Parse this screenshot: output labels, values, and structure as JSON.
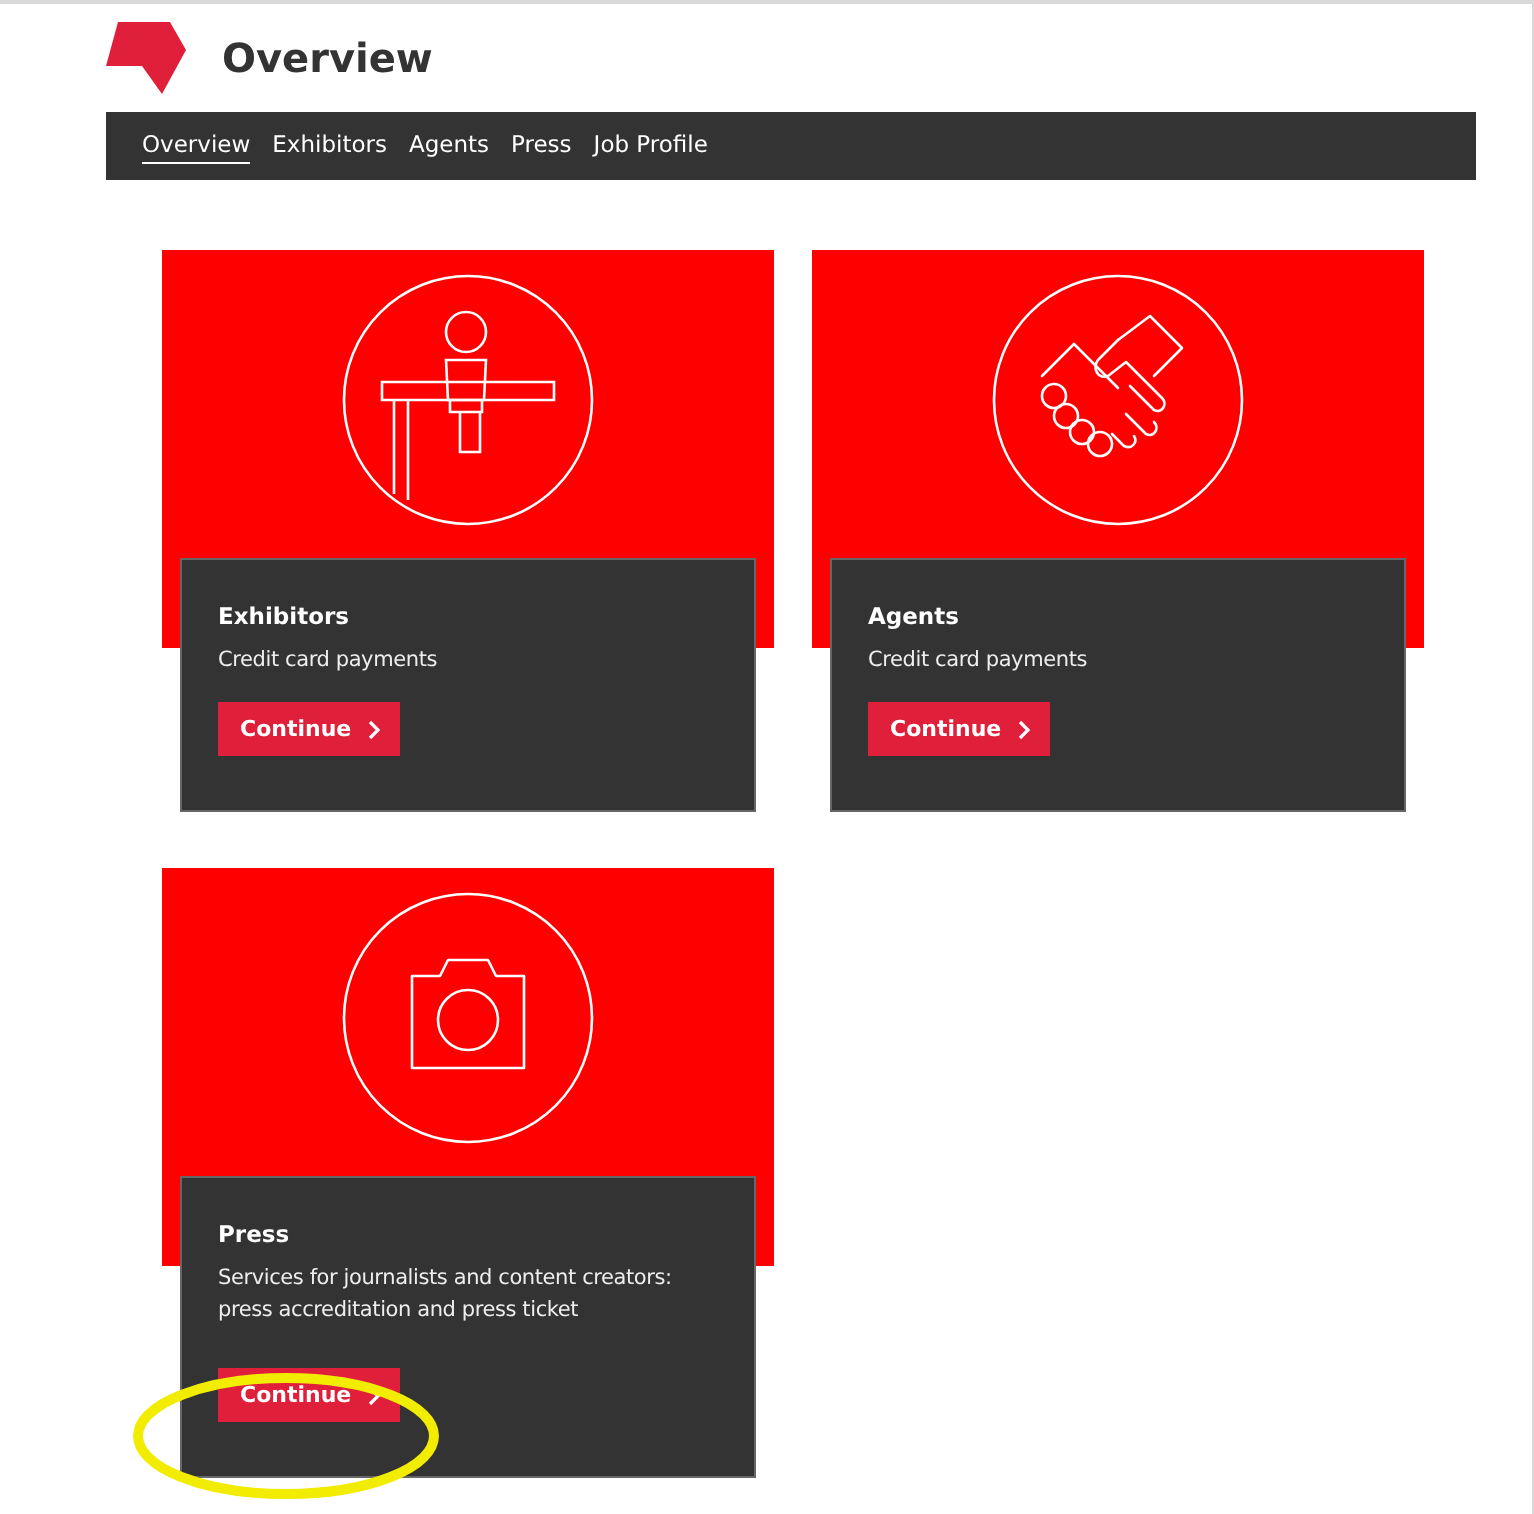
{
  "header": {
    "title": "Overview"
  },
  "nav": [
    {
      "label": "Overview",
      "selected": true
    },
    {
      "label": "Exhibitors",
      "selected": false
    },
    {
      "label": "Agents",
      "selected": false
    },
    {
      "label": "Press",
      "selected": false
    },
    {
      "label": "Job Profile",
      "selected": false
    }
  ],
  "cards": [
    {
      "kind": "exhibitor",
      "title": "Exhibitors",
      "description": "Credit card payments",
      "button": "Continue",
      "highlighted": false
    },
    {
      "kind": "handshake",
      "title": "Agents",
      "description": "Credit card payments",
      "button": "Continue",
      "highlighted": false
    },
    {
      "kind": "camera",
      "title": "Press",
      "description": "Services for journalists and content creators: press accreditation and press ticket",
      "button": "Continue",
      "highlighted": true
    }
  ]
}
